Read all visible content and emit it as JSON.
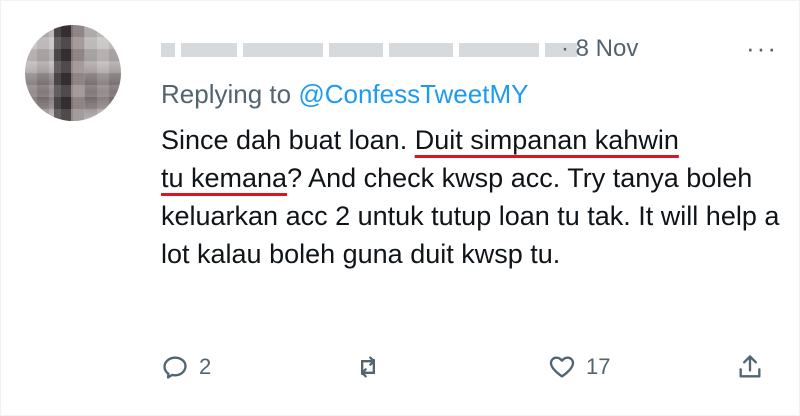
{
  "tweet": {
    "date": "· 8 Nov",
    "more": "···",
    "replying_to_prefix": "Replying to ",
    "replying_to_handle": "@ConfessTweetMY",
    "text_part1": "Since dah buat loan. ",
    "text_underlined1": "Duit simpanan kahwin",
    "text_underlined2": "tu kemana",
    "text_part2": "? And check kwsp acc. Try tanya boleh keluarkan acc 2 untuk tutup loan tu tak. It will help a lot kalau boleh guna duit kwsp tu."
  },
  "actions": {
    "reply_count": "2",
    "retweet_count": "",
    "like_count": "17"
  },
  "colors": {
    "accent": "#1d9bf0",
    "muted": "#536471",
    "underline": "#e0141e"
  },
  "icons": [
    "reply-icon",
    "retweet-icon",
    "like-icon",
    "share-icon",
    "more-icon"
  ]
}
